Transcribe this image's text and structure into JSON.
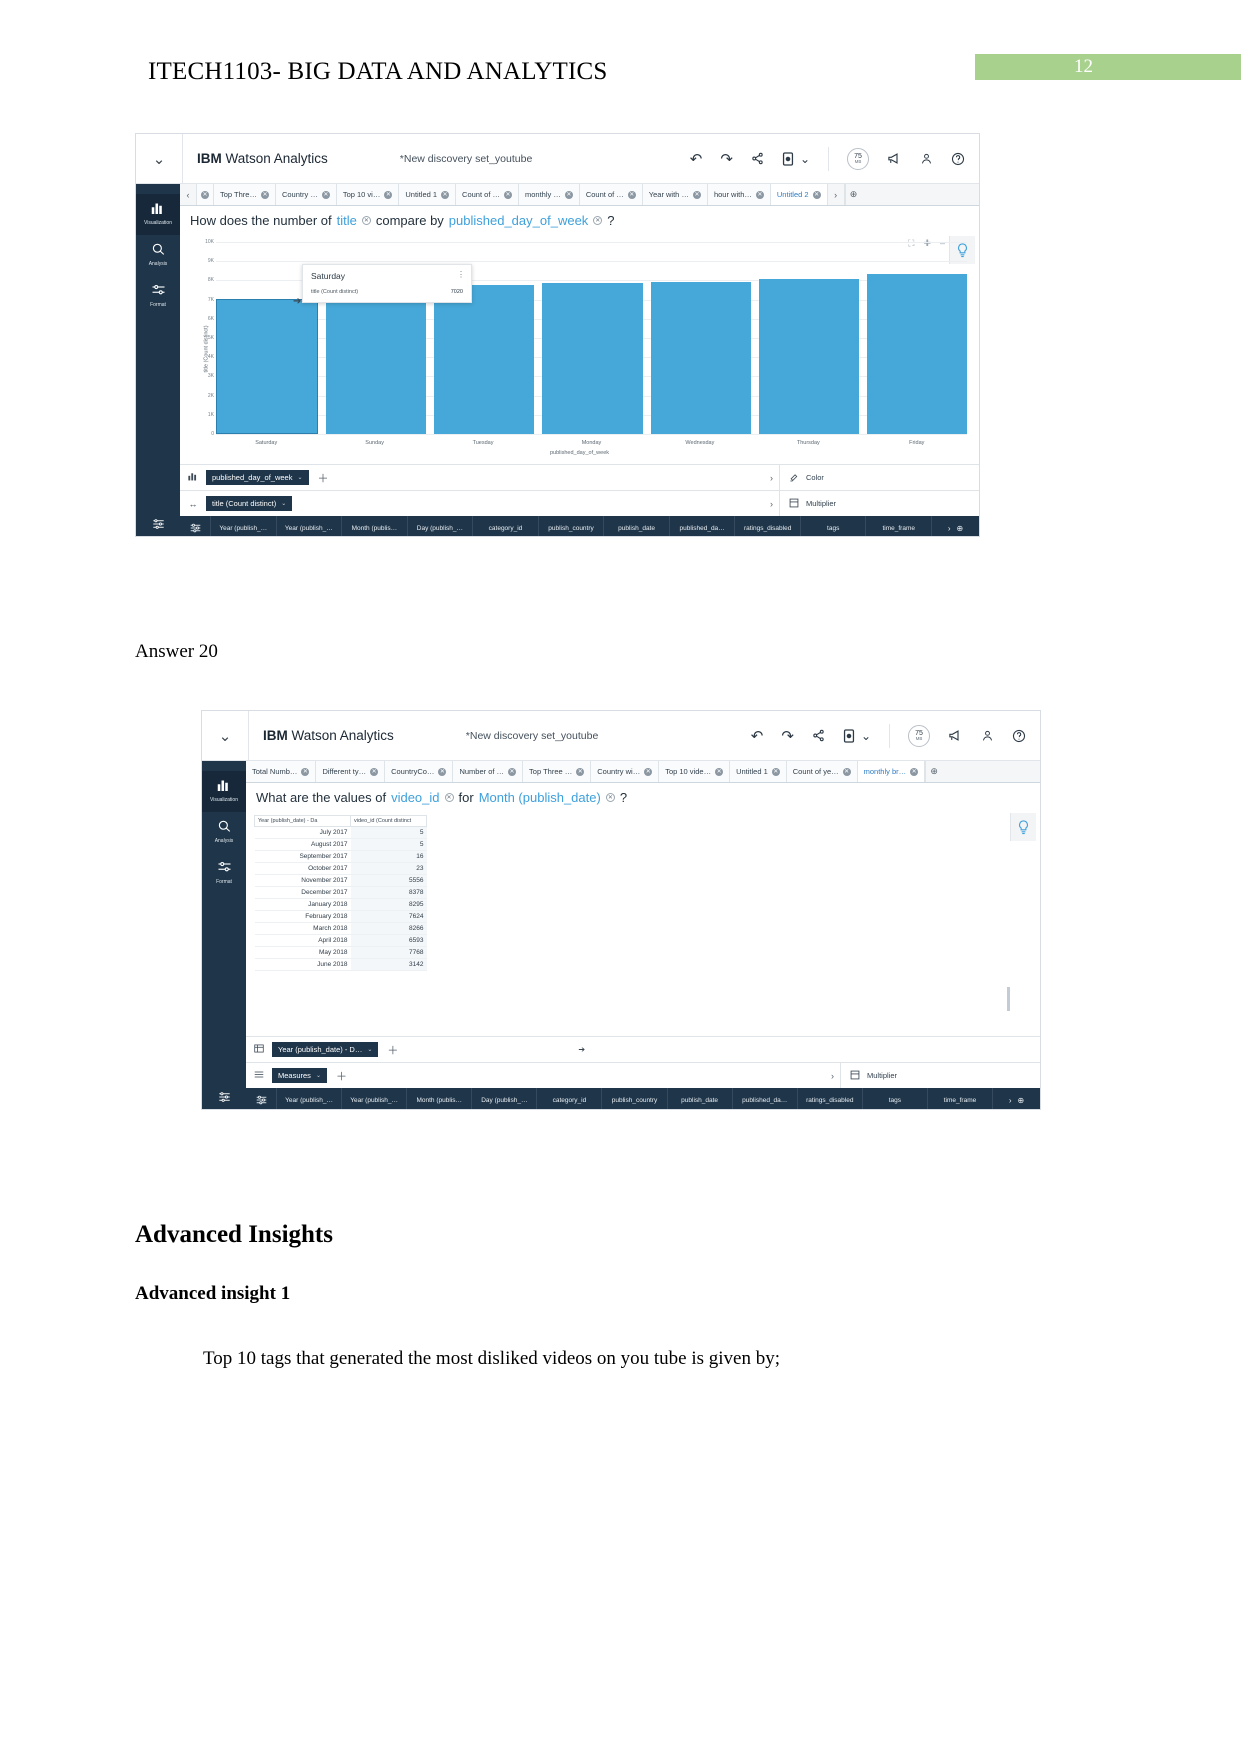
{
  "document": {
    "header_title": "ITECH1103- BIG DATA AND ANALYTICS",
    "page_number": "12",
    "page_badge_color": "#a9d18e",
    "answer_label": "Answer 20",
    "section_heading": "Advanced Insights",
    "subsection_heading": "Advanced insight 1",
    "paragraph": "Top 10 tags that generated the most disliked videos on you tube is given by;"
  },
  "app1": {
    "topbar": {
      "chevron_icon": "chevron-down-icon",
      "brand_bold": "IBM",
      "brand_rest": " Watson Analytics",
      "document_name": "*New discovery set_youtube",
      "icons": [
        {
          "name": "undo-icon",
          "glyph": "↶"
        },
        {
          "name": "redo-icon",
          "glyph": "↷"
        },
        {
          "name": "share-icon",
          "glyph": "‹"
        },
        {
          "name": "display-mode-icon",
          "glyph": "▣"
        },
        {
          "name": "display-mode-chevron-icon",
          "glyph": "⌄"
        }
      ],
      "memory_value": "75",
      "memory_unit": "MB",
      "announce_icon": "megaphone-icon",
      "account_icon": "user-icon",
      "help_icon": "help-icon"
    },
    "rail": [
      {
        "label": "Visualization",
        "glyph": "Ὄa",
        "icon": "bar-chart-icon",
        "active": true
      },
      {
        "label": "Analysis",
        "glyph": "ⓘ",
        "icon": "magnifier-icon",
        "active": false
      },
      {
        "label": "Format",
        "glyph": "☲",
        "icon": "sliders-icon",
        "active": false
      }
    ],
    "tabs": [
      {
        "label": "Top Thre…",
        "selected": false
      },
      {
        "label": "Country …",
        "selected": false
      },
      {
        "label": "Top 10 vi…",
        "selected": false
      },
      {
        "label": "Untitled 1",
        "selected": false
      },
      {
        "label": "Count of …",
        "selected": false
      },
      {
        "label": "monthly …",
        "selected": false
      },
      {
        "label": "Count of …",
        "selected": false
      },
      {
        "label": "Year with …",
        "selected": false
      },
      {
        "label": "hour with…",
        "selected": false
      },
      {
        "label": "Untitled 2",
        "selected": true
      }
    ],
    "question": {
      "part1": "How does the number of",
      "field1": "title",
      "part2": "compare by",
      "field2": "published_day_of_week",
      "question_mark": "?"
    },
    "tooltip": {
      "title": "Saturday",
      "measure_label": "title (Count distinct)",
      "measure_value": "7020"
    },
    "shelves": [
      {
        "icon": "bar-chart-icon",
        "pill": "published_day_of_week",
        "right_icon": "color-icon",
        "right_label": "Color"
      },
      {
        "icon": "arrows-icon",
        "pill": "title (Count distinct)",
        "right_icon": "multiplier-icon",
        "right_label": "Multiplier"
      }
    ],
    "fieldbar": [
      "Year (publish_…",
      "Year (publish_…",
      "Month (publis…",
      "Day (publish_…",
      "category_id",
      "publish_country",
      "publish_date",
      "published_da…",
      "ratings_disabled",
      "tags",
      "time_frame"
    ]
  },
  "app1_chart": {
    "chart_data": {
      "type": "bar",
      "title": "",
      "xlabel": "published_day_of_week",
      "ylabel": "title (Count distinct)",
      "categories": [
        "Saturday",
        "Sunday",
        "Tuesday",
        "Monday",
        "Wednesday",
        "Thursday",
        "Friday"
      ],
      "values": [
        7020,
        7580,
        7760,
        7870,
        7900,
        8080,
        8320
      ],
      "ylim": [
        0,
        10000
      ],
      "yticks": [
        "10K",
        "9K",
        "8K",
        "7K",
        "6K",
        "5K",
        "4K",
        "3K",
        "2K",
        "1K",
        "0"
      ],
      "grid": true,
      "bar_color": "#46a8d8",
      "legend": "none",
      "highlighted_category": "Saturday"
    }
  },
  "app2": {
    "topbar": {
      "chevron_icon": "chevron-down-icon",
      "brand_bold": "IBM",
      "brand_rest": " Watson Analytics",
      "document_name": "*New discovery set_youtube",
      "memory_value": "75",
      "memory_unit": "MB"
    },
    "rail": [
      {
        "label": "Visualization",
        "active": true
      },
      {
        "label": "Analysis",
        "active": false
      },
      {
        "label": "Format",
        "active": false
      }
    ],
    "tabs": [
      {
        "label": "Total Numb…",
        "selected": false
      },
      {
        "label": "Different ty…",
        "selected": false
      },
      {
        "label": "CountryCo…",
        "selected": false
      },
      {
        "label": "Number of …",
        "selected": false
      },
      {
        "label": "Top Three …",
        "selected": false
      },
      {
        "label": "Country wi…",
        "selected": false
      },
      {
        "label": "Top 10 vide…",
        "selected": false
      },
      {
        "label": "Untitled 1",
        "selected": false
      },
      {
        "label": "Count of ye…",
        "selected": false
      },
      {
        "label": "monthly br…",
        "selected": true
      }
    ],
    "question": {
      "part1": "What are the values of",
      "field1": "video_id",
      "part2": "for",
      "field2": "Month (publish_date)",
      "question_mark": "?"
    },
    "shelves": [
      {
        "icon": "rows-icon",
        "pill": "Year (publish_date) - D…",
        "right_icon": "",
        "right_label": ""
      },
      {
        "icon": "measures-icon",
        "pill": "Measures",
        "right_icon": "multiplier-icon",
        "right_label": "Multiplier"
      }
    ],
    "fieldbar": [
      "Year (publish_…",
      "Year (publish_…",
      "Month (publis…",
      "Day (publish_…",
      "category_id",
      "publish_country",
      "publish_date",
      "published_da…",
      "ratings_disabled",
      "tags",
      "time_frame"
    ]
  },
  "app2_chart": {
    "chart_data": {
      "type": "table",
      "title": "",
      "columns": [
        "Year (publish_date) - Da",
        "video_id (Count distinct"
      ],
      "categories": [
        "July 2017",
        "August 2017",
        "September 2017",
        "October 2017",
        "November 2017",
        "December 2017",
        "January 2018",
        "February 2018",
        "March 2018",
        "April 2018",
        "May 2018",
        "June 2018"
      ],
      "values": [
        5,
        5,
        16,
        23,
        5556,
        8378,
        8295,
        7624,
        8266,
        6593,
        7768,
        3142
      ],
      "xlabel": "Month (publish_date)",
      "ylabel": "video_id (Count distinct)"
    }
  }
}
